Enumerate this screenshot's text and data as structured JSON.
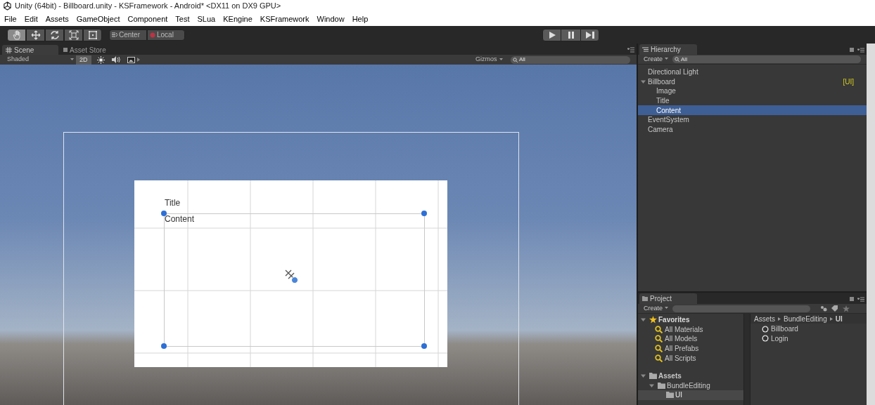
{
  "window": {
    "title": "Unity (64bit) - Billboard.unity - KSFramework - Android* <DX11 on DX9 GPU>"
  },
  "menu": [
    "File",
    "Edit",
    "Assets",
    "GameObject",
    "Component",
    "Test",
    "SLua",
    "KEngine",
    "KSFramework",
    "Window",
    "Help"
  ],
  "toolbar": {
    "tools": [
      {
        "kind": "hand",
        "selected": true
      },
      {
        "kind": "move",
        "selected": false
      },
      {
        "kind": "rotate",
        "selected": false
      },
      {
        "kind": "scale",
        "selected": false
      },
      {
        "kind": "rect",
        "selected": false
      }
    ],
    "pivot_buttons": [
      "Center",
      "Local"
    ]
  },
  "scene": {
    "tabs": [
      {
        "label": "Scene",
        "selected": true
      },
      {
        "label": "Asset Store",
        "selected": false
      }
    ],
    "shading": "Shaded",
    "mode_2d": {
      "label": "2D",
      "on": true
    },
    "gizmos": "Gizmos",
    "search": {
      "placeholder": "All"
    },
    "canvas_texts": [
      "Title",
      "Content"
    ]
  },
  "hierarchy": {
    "tab": "Hierarchy",
    "create": "Create",
    "search": {
      "placeholder": "All"
    },
    "items": [
      {
        "label": "Directional Light",
        "selected": false
      },
      {
        "label": "Billboard",
        "selected": false,
        "expanded": true,
        "badge": "[UI]",
        "children": [
          {
            "label": "Image",
            "selected": false
          },
          {
            "label": "Title",
            "selected": false
          },
          {
            "label": "Content",
            "selected": true
          }
        ]
      },
      {
        "label": "EventSystem",
        "selected": false
      },
      {
        "label": "Camera",
        "selected": false
      }
    ]
  },
  "project": {
    "tab": "Project",
    "create": "Create",
    "favorites": {
      "label": "Favorites",
      "expanded": true,
      "items": [
        "All Materials",
        "All Models",
        "All Prefabs",
        "All Scripts"
      ]
    },
    "folders": [
      {
        "label": "Assets",
        "selected": false,
        "expanded": true,
        "children": [
          {
            "label": "BundleEditing",
            "selected": false,
            "expanded": true,
            "children": [
              {
                "label": "UI",
                "selected": true
              }
            ]
          }
        ]
      }
    ],
    "breadcrumb": [
      "Assets",
      "BundleEditing",
      "UI"
    ],
    "files": [
      "Billboard",
      "Login"
    ]
  }
}
